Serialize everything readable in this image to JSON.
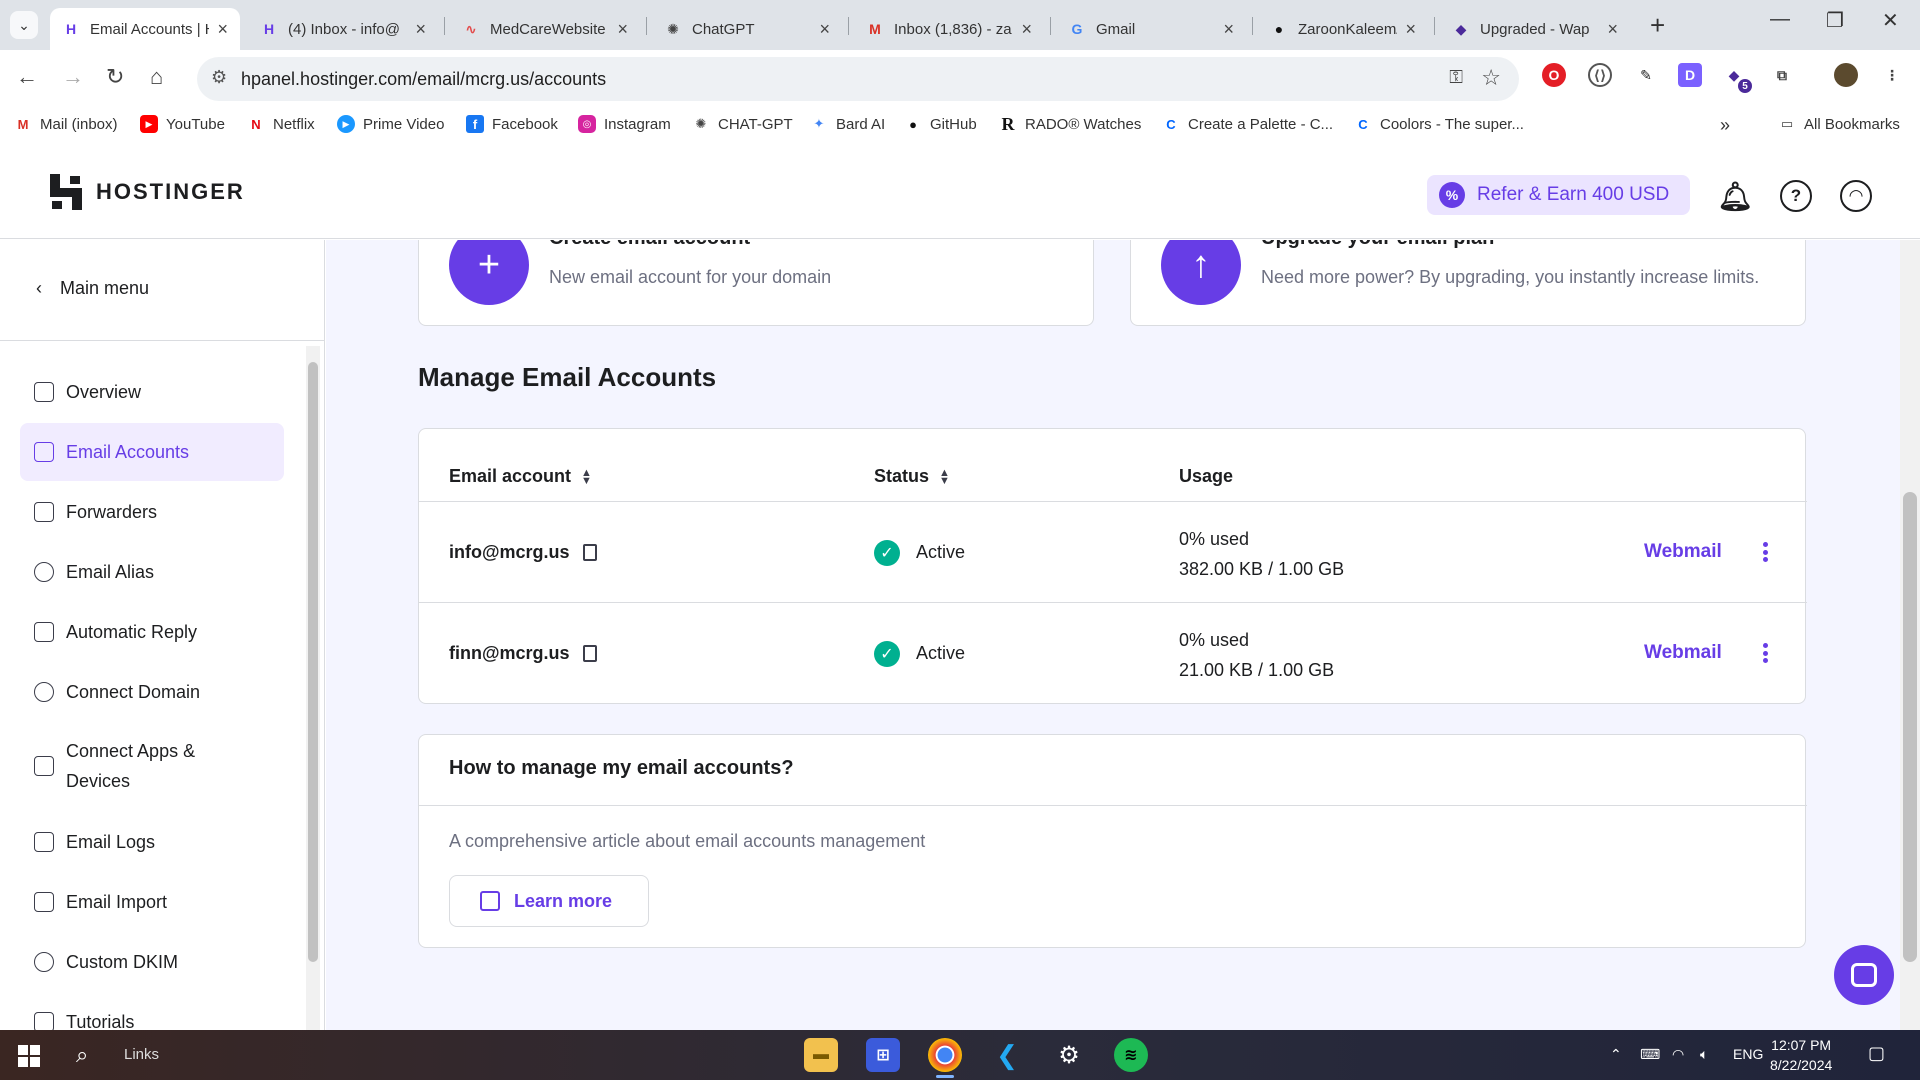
{
  "browser": {
    "tabs": [
      {
        "title": "Email Accounts | Ho",
        "favicon": "hostinger-icon",
        "active": true
      },
      {
        "title": "(4) Inbox - info@",
        "favicon": "hostinger-icon",
        "active": false
      },
      {
        "title": "MedCareWebsite",
        "favicon": "medcare-icon",
        "active": false
      },
      {
        "title": "ChatGPT",
        "favicon": "chatgpt-icon",
        "active": false
      },
      {
        "title": "Inbox (1,836) - za",
        "favicon": "gmail-icon",
        "active": false
      },
      {
        "title": "Gmail",
        "favicon": "google-icon",
        "active": false
      },
      {
        "title": "ZaroonKaleem/N",
        "favicon": "github-icon",
        "active": false
      },
      {
        "title": "Upgraded - Wap",
        "favicon": "upgraded-icon",
        "active": false
      }
    ],
    "url": "hpanel.hostinger.com/email/mcrg.us/accounts",
    "bookmarks": [
      {
        "label": "Mail (inbox)",
        "icon": "gmail-icon"
      },
      {
        "label": "YouTube",
        "icon": "youtube-icon"
      },
      {
        "label": "Netflix",
        "icon": "netflix-icon"
      },
      {
        "label": "Prime Video",
        "icon": "prime-video-icon"
      },
      {
        "label": "Facebook",
        "icon": "facebook-icon"
      },
      {
        "label": "Instagram",
        "icon": "instagram-icon"
      },
      {
        "label": "CHAT-GPT",
        "icon": "chatgpt-icon"
      },
      {
        "label": "Bard AI",
        "icon": "bard-icon"
      },
      {
        "label": "GitHub",
        "icon": "github-icon"
      },
      {
        "label": "RADO® Watches",
        "icon": "rado-icon"
      },
      {
        "label": "Create a Palette - C...",
        "icon": "coolors-icon"
      },
      {
        "label": "Coolors - The super...",
        "icon": "coolors-icon"
      }
    ],
    "all_bookmarks": "All Bookmarks",
    "extension_badge": "5"
  },
  "header": {
    "logo_text": "HOSTINGER",
    "refer_label": "Refer & Earn 400 USD"
  },
  "sidebar": {
    "main_menu": "Main menu",
    "items": [
      {
        "label": "Overview",
        "icon": "overview-icon"
      },
      {
        "label": "Email Accounts",
        "icon": "inbox-icon",
        "active": true
      },
      {
        "label": "Forwarders",
        "icon": "forward-mail-icon"
      },
      {
        "label": "Email Alias",
        "icon": "at-sign-icon"
      },
      {
        "label": "Automatic Reply",
        "icon": "auto-reply-icon"
      },
      {
        "label": "Connect Domain",
        "icon": "globe-icon"
      },
      {
        "label": "Connect Apps & Devices",
        "icon": "devices-icon"
      },
      {
        "label": "Email Logs",
        "icon": "logs-icon"
      },
      {
        "label": "Email Import",
        "icon": "download-icon"
      },
      {
        "label": "Custom DKIM",
        "icon": "gear-icon"
      },
      {
        "label": "Tutorials",
        "icon": "book-icon"
      }
    ]
  },
  "main": {
    "create_card": {
      "title": "Create email account",
      "subtitle": "New email account for your domain"
    },
    "upgrade_card": {
      "title": "Upgrade your email plan",
      "subtitle": "Need more power? By upgrading, you instantly increase limits."
    },
    "section_title": "Manage Email Accounts",
    "table": {
      "headers": {
        "email": "Email account",
        "status": "Status",
        "usage": "Usage"
      },
      "rows": [
        {
          "email": "info@mcrg.us",
          "status": "Active",
          "usage_pct": "0% used",
          "usage_detail": "382.00 KB / 1.00 GB",
          "action": "Webmail"
        },
        {
          "email": "finn@mcrg.us",
          "status": "Active",
          "usage_pct": "0% used",
          "usage_detail": "21.00 KB / 1.00 GB",
          "action": "Webmail"
        }
      ]
    },
    "help": {
      "title": "How to manage my email accounts?",
      "text": "A comprehensive article about email accounts management",
      "button": "Learn more"
    }
  },
  "taskbar": {
    "search_label": "Links",
    "lang": "ENG",
    "time": "12:07 PM",
    "date": "8/22/2024"
  },
  "colors": {
    "brand": "#673de6",
    "active_bg": "#f1ecff",
    "success": "#00b090"
  }
}
